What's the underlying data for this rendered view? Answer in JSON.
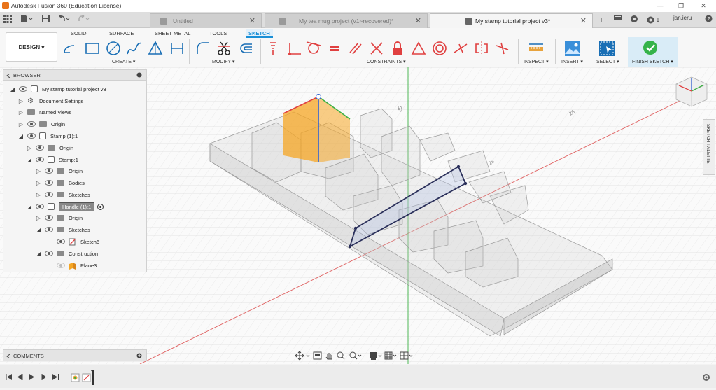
{
  "window": {
    "title": "Autodesk Fusion 360 (Education License)",
    "controls": [
      "—",
      "❐",
      "✕"
    ]
  },
  "tabs": [
    {
      "label": "Untitled",
      "active": false
    },
    {
      "label": "My tea mug project (v1~recovered)*",
      "active": false
    },
    {
      "label": "My stamp tutorial project v3*",
      "active": true
    }
  ],
  "user": {
    "notification_count": "1",
    "name": "jan.ieru"
  },
  "ribbon": {
    "workspace": "DESIGN ▾",
    "tabs": [
      "SOLID",
      "SURFACE",
      "SHEET METAL",
      "TOOLS",
      "SKETCH"
    ],
    "active_tab": "SKETCH",
    "groups": {
      "create": "CREATE ▾",
      "modify": "MODIFY ▾",
      "constraints": "CONSTRAINTS ▾",
      "inspect": "INSPECT ▾",
      "insert": "INSERT ▾",
      "select": "SELECT ▾",
      "finish": "FINISH SKETCH ▾"
    }
  },
  "browser": {
    "title": "BROWSER",
    "items": [
      {
        "label": "My stamp tutorial project v3",
        "type": "comp"
      },
      {
        "label": "Document Settings",
        "type": "gear"
      },
      {
        "label": "Named Views",
        "type": "folder"
      },
      {
        "label": "Origin",
        "type": "folder"
      },
      {
        "label": "Stamp (1):1",
        "type": "comp"
      },
      {
        "label": "Origin",
        "type": "folder"
      },
      {
        "label": "Stamp:1",
        "type": "comp"
      },
      {
        "label": "Origin",
        "type": "folder"
      },
      {
        "label": "Bodies",
        "type": "folder"
      },
      {
        "label": "Sketches",
        "type": "folder"
      },
      {
        "label": "Handle (1):1",
        "type": "comp"
      },
      {
        "label": "Origin",
        "type": "folder"
      },
      {
        "label": "Sketches",
        "type": "folder"
      },
      {
        "label": "Sketch6",
        "type": "sketch"
      },
      {
        "label": "Construction",
        "type": "folder"
      },
      {
        "label": "Plane3",
        "type": "plane"
      }
    ]
  },
  "comments": {
    "title": "COMMENTS"
  },
  "side_palette": {
    "label": "SKETCH PALETTE"
  },
  "viewport": {
    "axis_labels": [
      "25",
      "25",
      "25"
    ]
  },
  "colors": {
    "accent": "#1a8fd6",
    "finish_check": "#35b34a",
    "plane_orange": "#f5a623",
    "axis_red": "#e05050",
    "axis_green": "#3cb043",
    "sketch_line": "#2a2f5a"
  }
}
